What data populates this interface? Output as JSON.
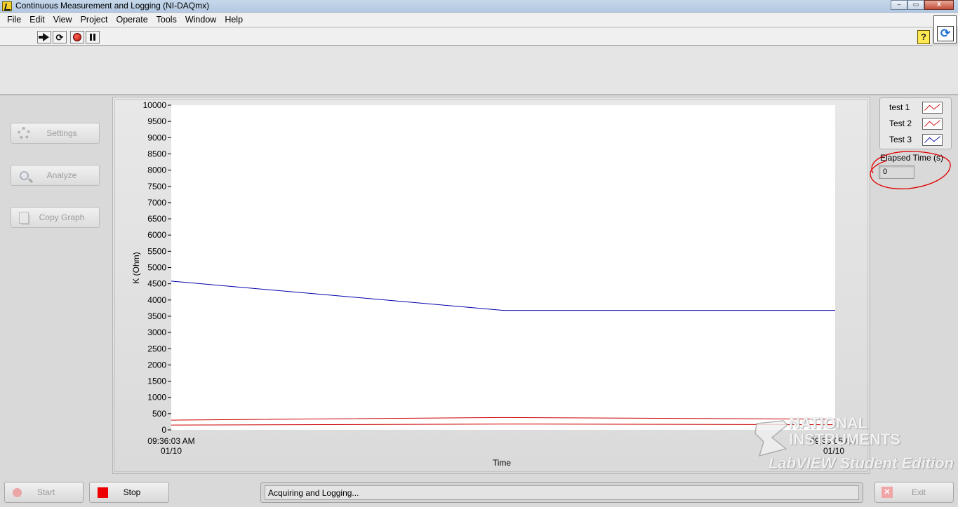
{
  "window": {
    "title": "Continuous Measurement and Logging (NI-DAQmx)",
    "controls": {
      "minimize": "–",
      "restore": "▭",
      "close": "X"
    }
  },
  "menu": [
    "File",
    "Edit",
    "View",
    "Project",
    "Operate",
    "Tools",
    "Window",
    "Help"
  ],
  "toolbar": {
    "help_glyph": "?"
  },
  "side_buttons": {
    "settings": "Settings",
    "analyze": "Analyze",
    "copy_graph": "Copy Graph"
  },
  "legend": [
    {
      "name": "test 1",
      "color": "#cc0000"
    },
    {
      "name": "Test 2",
      "color": "#cc0000"
    },
    {
      "name": "Test 3",
      "color": "#0000aa"
    }
  ],
  "elapsed": {
    "label": "Elapsed Time (s)",
    "value": "0",
    "annotation_color": "#e00000"
  },
  "bottom": {
    "start": "Start",
    "stop": "Stop",
    "exit": "Exit",
    "status": "Acquiring and Logging..."
  },
  "watermark": {
    "line1": "NATIONAL",
    "line2": "INSTRUMENTS",
    "line3": "LabVIEW Student Edition"
  },
  "chart_data": {
    "type": "line",
    "xlabel": "Time",
    "ylabel": "K (Ohm)",
    "ylim": [
      0,
      10000
    ],
    "yticks": [
      0,
      500,
      1000,
      1500,
      2000,
      2500,
      3000,
      3500,
      4000,
      4500,
      5000,
      5500,
      6000,
      6500,
      7000,
      7500,
      8000,
      8500,
      9000,
      9500,
      10000
    ],
    "x_tick_labels": [
      {
        "time": "09:36:03 AM",
        "date": "01/10"
      },
      {
        "time": "09:36:05 AM",
        "date": "01/10"
      }
    ],
    "x": [
      0,
      1,
      2
    ],
    "series": [
      {
        "name": "test 1",
        "color": "#cc0000",
        "values": [
          300,
          380,
          330
        ]
      },
      {
        "name": "Test 2",
        "color": "#cc0000",
        "values": [
          150,
          180,
          160
        ]
      },
      {
        "name": "Test 3",
        "color": "#0000aa",
        "values": [
          4580,
          3680,
          3680
        ]
      }
    ],
    "grid": false
  }
}
